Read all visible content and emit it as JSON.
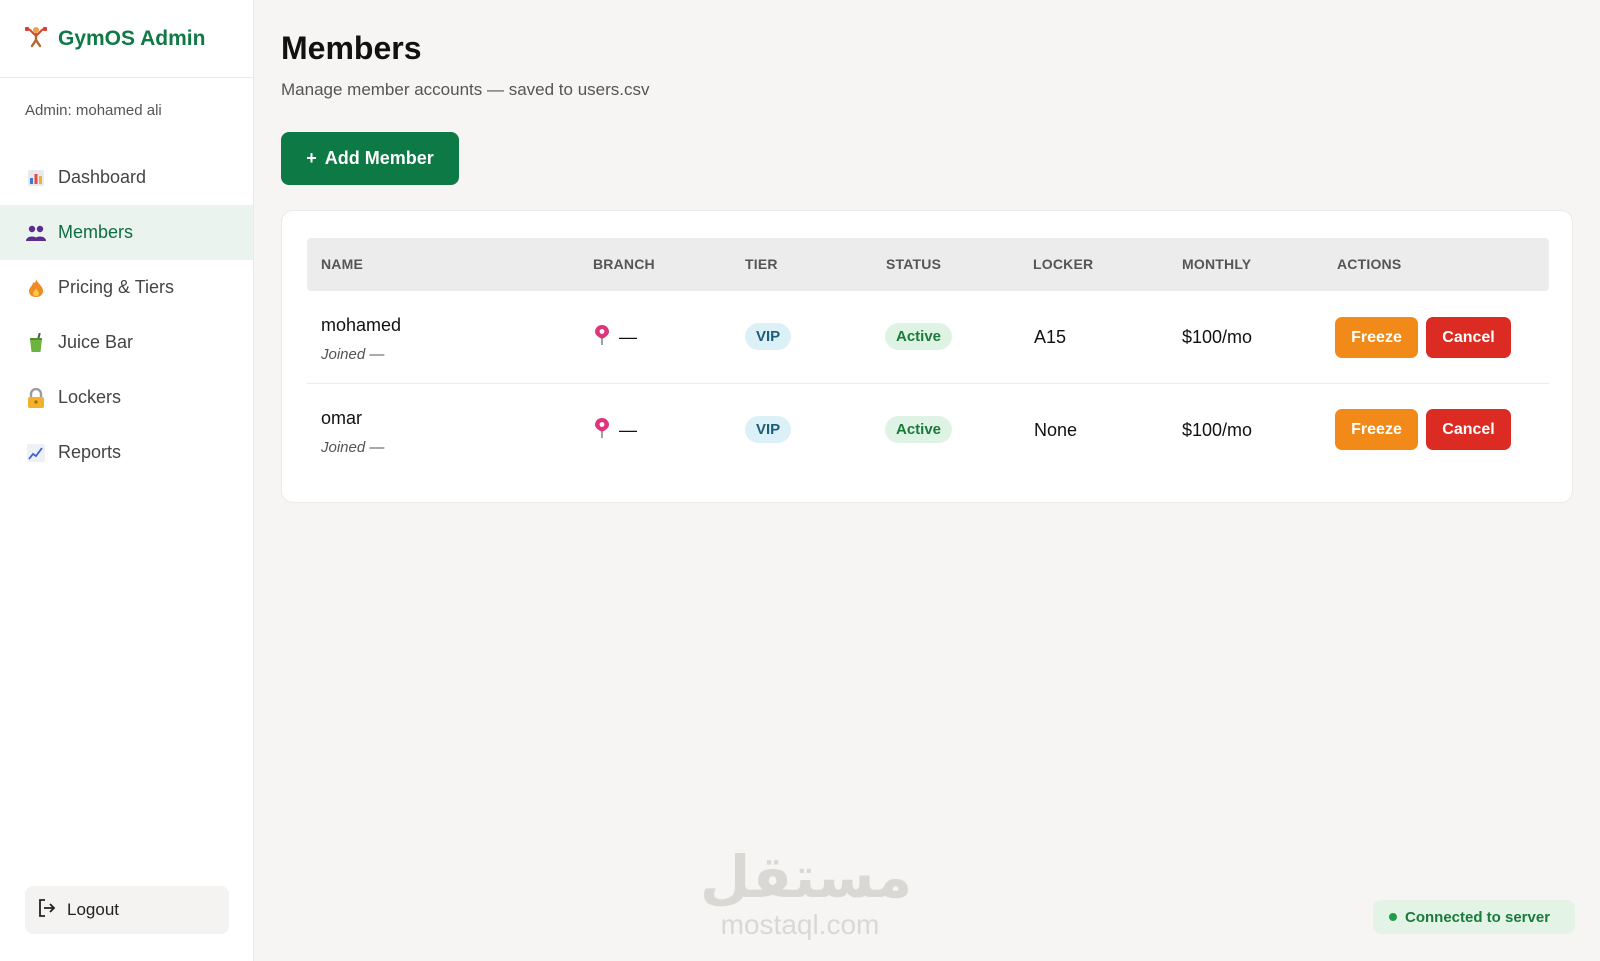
{
  "brand": {
    "title": "GymOS Admin",
    "icon": "weightlifter-icon"
  },
  "admin_label": "Admin: mohamed ali",
  "nav": [
    {
      "label": "Dashboard",
      "icon": "bar-chart-icon",
      "active": false
    },
    {
      "label": "Members",
      "icon": "users-icon",
      "active": true
    },
    {
      "label": "Pricing & Tiers",
      "icon": "fire-icon",
      "active": false
    },
    {
      "label": "Juice Bar",
      "icon": "juice-icon",
      "active": false
    },
    {
      "label": "Lockers",
      "icon": "lock-icon",
      "active": false
    },
    {
      "label": "Reports",
      "icon": "trend-chart-icon",
      "active": false
    }
  ],
  "logout_label": "Logout",
  "page": {
    "title": "Members",
    "subtitle": "Manage member accounts — saved to users.csv",
    "add_label": "Add Member",
    "add_icon_text": "+"
  },
  "table": {
    "headers": {
      "name": "NAME",
      "branch": "BRANCH",
      "tier": "TIER",
      "status": "STATUS",
      "locker": "LOCKER",
      "monthly": "MONTHLY",
      "actions": "ACTIONS"
    },
    "rows": [
      {
        "name": "mohamed",
        "joined": "Joined —",
        "branch": "—",
        "tier": "VIP",
        "status": "Active",
        "locker": "A15",
        "monthly": "$100/mo",
        "freeze": "Freeze",
        "cancel": "Cancel"
      },
      {
        "name": "omar",
        "joined": "Joined —",
        "branch": "—",
        "tier": "VIP",
        "status": "Active",
        "locker": "None",
        "monthly": "$100/mo",
        "freeze": "Freeze",
        "cancel": "Cancel"
      }
    ]
  },
  "watermark": {
    "arabic": "مستقل",
    "latin": "mostaql.com"
  },
  "connection_status": "Connected to server",
  "colors": {
    "brand_green": "#0f7a45",
    "freeze_orange": "#f28a1a",
    "cancel_red": "#dc2b22",
    "active_bg": "#eaf3ee"
  }
}
